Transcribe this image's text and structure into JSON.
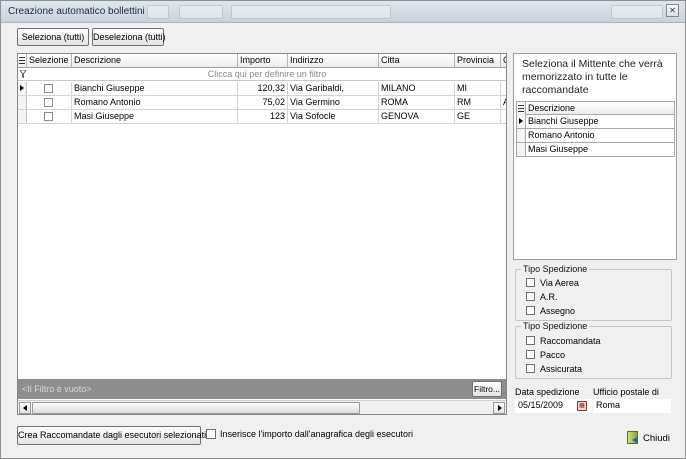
{
  "window": {
    "title": "Creazione automatico bollettini",
    "close_glyph": "✕"
  },
  "toolbar": {
    "select_all": "Seleziona (tutti)",
    "deselect_all": "Deseleziona (tutti)"
  },
  "grid": {
    "columns": [
      "Selezione",
      "Descrizione",
      "Importo",
      "Indirizzo",
      "Citta",
      "Provincia",
      "C"
    ],
    "filter_hint": "Clicca qui per definire un filtro",
    "rows": [
      {
        "selected": false,
        "descrizione": "Bianchi Giuseppe",
        "importo": "120,32",
        "indirizzo": "Via Garibaldi,",
        "citta": "MILANO",
        "provincia": "MI",
        "c": ""
      },
      {
        "selected": false,
        "descrizione": "Romano Antonio",
        "importo": "75,02",
        "indirizzo": "Via Germino",
        "citta": "ROMA",
        "provincia": "RM",
        "c": "A"
      },
      {
        "selected": false,
        "descrizione": "Masi Giuseppe",
        "importo": "123",
        "indirizzo": "Via Sofocle",
        "citta": "GENOVA",
        "provincia": "GE",
        "c": ""
      }
    ],
    "current_row_index": 0,
    "status_text": "<Il Filtro è vuoto>",
    "filter_button": "Filtro..."
  },
  "mittente": {
    "title": "Seleziona il Mittente che verrà memorizzato in tutte le raccomandate",
    "column": "Descrizione",
    "items": [
      "Bianchi Giuseppe",
      "Romano Antonio",
      "Masi Giuseppe"
    ],
    "current_index": 0
  },
  "tipo_spedizione_1": {
    "legend": "Tipo Spedizione",
    "options": [
      "Via Aerea",
      "A.R.",
      "Assegno"
    ]
  },
  "tipo_spedizione_2": {
    "legend": "Tipo Spedizione",
    "options": [
      "Raccomandata",
      "Pacco",
      "Assicurata"
    ]
  },
  "spedizione": {
    "date_label": "Data spedizione",
    "date_value": "05/15/2009",
    "office_label": "Ufficio postale di",
    "office_value": "Roma"
  },
  "bottom": {
    "create_button": "Crea Raccomandate dagli esecutori selezionati",
    "import_checkbox_label": "Inserisce l'importo dall'anagrafica degli esecutori",
    "close_button": "Chiudi"
  },
  "colors": {
    "window_bg": "#f0f0f0",
    "status_bar": "#8e8e8e"
  }
}
